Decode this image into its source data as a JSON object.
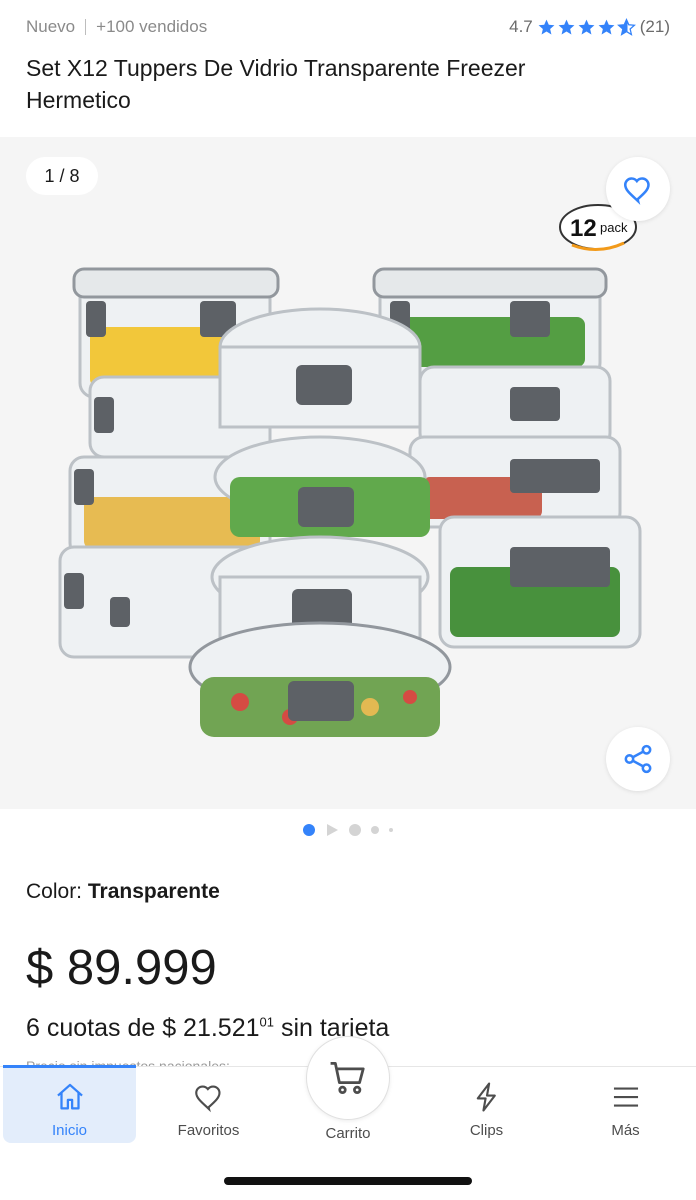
{
  "header": {
    "condition": "Nuevo",
    "sold": "+100 vendidos",
    "rating_value": "4.7",
    "rating_count": "(21)",
    "rating_stars": 4.7
  },
  "product": {
    "title": "Set X12 Tuppers De Vidrio Transparente Freezer Hermetico",
    "image_counter": "1 / 8",
    "pack_badge": "12 pack",
    "color_label": "Color:",
    "color_value": "Transparente",
    "price": "$ 89.999",
    "installments_prefix": "6 cuotas de $ 21.521",
    "installments_cents": "01",
    "installments_suffix": " sin tarjeta",
    "tax_note": "Precio sin impuestos nacionales:"
  },
  "gallery": {
    "total_images": 8,
    "active_index": 1
  },
  "nav": {
    "items": [
      {
        "label": "Inicio",
        "icon": "home-icon"
      },
      {
        "label": "Favoritos",
        "icon": "heart-icon"
      },
      {
        "label": "Carrito",
        "icon": "cart-icon"
      },
      {
        "label": "Clips",
        "icon": "lightning-icon"
      },
      {
        "label": "Más",
        "icon": "menu-icon"
      }
    ]
  },
  "colors": {
    "accent": "#3483fa",
    "active_nav_bg": "#e3edfb",
    "muted_text": "#8a8a8a"
  }
}
